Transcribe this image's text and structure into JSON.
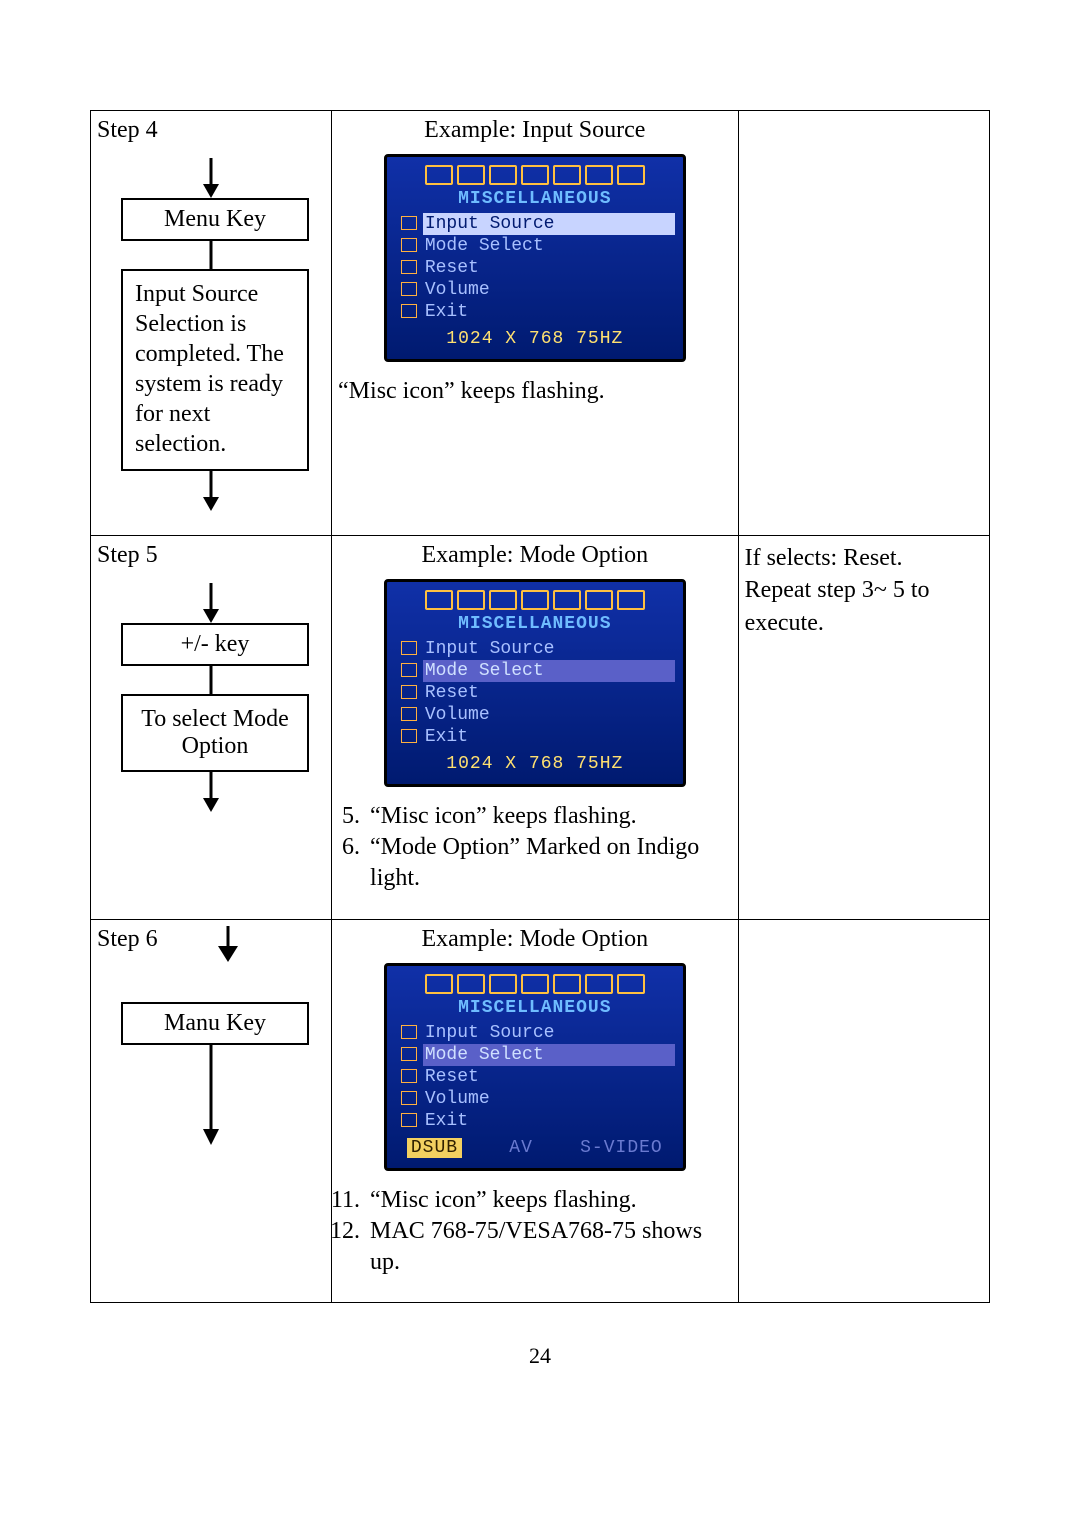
{
  "page_number": "24",
  "osd_common": {
    "title": "MISCELLANEOUS",
    "items": [
      "Input Source",
      "Mode Select",
      "Reset",
      "Volume",
      "Exit"
    ]
  },
  "rows": [
    {
      "step": "Step 4",
      "box": "Menu Key",
      "desc": "Input Source Selection is completed. The system is ready for next selection.",
      "example_title": "Example: Input Source",
      "status_plain": "1024 X 768 75HZ",
      "caption_after": "“Misc icon” keeps flashing.",
      "side": ""
    },
    {
      "step": "Step 5",
      "box": "+/-  key",
      "desc": "To select Mode Option",
      "example_title": "Example: Mode Option",
      "status_plain": "1024 X 768 75HZ",
      "ol_start": "5",
      "ol_items": [
        "“Misc icon” keeps flashing.",
        "“Mode Option” Marked on Indigo light."
      ],
      "side": "If selects: Reset.\nRepeat step 3~ 5 to execute."
    },
    {
      "step": "Step 6",
      "box": "Manu Key",
      "example_title": "Example: Mode Option",
      "status_tokens": {
        "a": "DSUB",
        "b": "AV",
        "c": "S-VIDEO"
      },
      "ol_start": "11",
      "ol_items": [
        "“Misc icon” keeps flashing.",
        "MAC 768-75/VESA768-75 shows up."
      ],
      "side": ""
    }
  ]
}
